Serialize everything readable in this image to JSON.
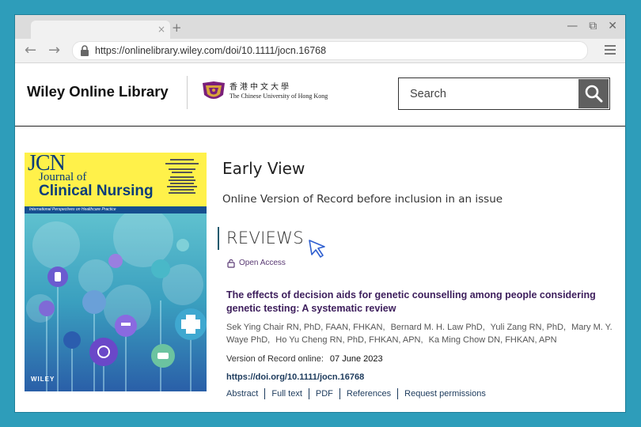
{
  "browser": {
    "tab_close": "×",
    "new_tab": "+",
    "back": "←",
    "forward": "→",
    "url": "https://onlinelibrary.wiley.com/doi/10.1111/jocn.16768",
    "window_controls": {
      "minimize": "—",
      "restore": "⧉",
      "close": "✕"
    }
  },
  "site": {
    "brand": "Wiley Online Library",
    "institution_cn": "香港中文大學",
    "institution_en": "The Chinese University of Hong Kong",
    "search": {
      "placeholder": "Search"
    }
  },
  "cover": {
    "jcn": "JCN",
    "journal_of": "Journal of",
    "clinical_nursing": "Clinical Nursing",
    "tagline": "International Perspectives on Healthcare Practice",
    "publisher": "WILEY",
    "colors": {
      "top": "#fff14a",
      "band": "#164f8f",
      "title": "#0a3c7a",
      "art": "#4aa6c0"
    }
  },
  "issue": {
    "title": "Early View",
    "subtitle": "Online Version of Record before inclusion in an issue"
  },
  "section": {
    "heading": "REVIEWS"
  },
  "article": {
    "access": "Open Access",
    "title": "The effects of decision aids for genetic counselling among people considering genetic testing: A systematic review",
    "authors": [
      "Sek Ying Chair RN, PhD, FAAN, FHKAN,",
      "Bernard M. H. Law PhD,",
      "Yuli Zang RN, PhD,",
      "Mary M. Y. Waye PhD,",
      "Ho Yu Cheng RN, PhD, FHKAN, APN,",
      "Ka Ming Chow DN, FHKAN, APN"
    ],
    "vor_label": "Version of Record online:",
    "vor_date": "07 June 2023",
    "doi": "https://doi.org/10.1111/jocn.16768",
    "links": [
      "Abstract",
      "Full text",
      "PDF",
      "References",
      "Request permissions"
    ]
  },
  "icons": [
    "lock-icon",
    "menu-icon",
    "search-icon",
    "cuhk-crest-icon",
    "open-access-lock-icon",
    "cursor-icon"
  ],
  "colors": {
    "page_bg": "#2e9dba",
    "accent": "#3d1e5c",
    "link": "#1c3a5c",
    "section_bar": "#1e5a6d"
  }
}
